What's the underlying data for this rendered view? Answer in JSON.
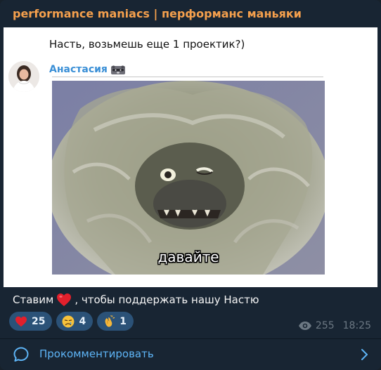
{
  "channel": {
    "title": "performance maniacs | перформанс маньяки"
  },
  "embed": {
    "question": "Насть, возьмешь еще 1 проектик?)",
    "author": "Анастасия",
    "author_emoji_icon": "raccoon-face-icon",
    "meme_caption": "давайте"
  },
  "message": {
    "before_emoji": "Ставим",
    "emoji_icon": "red-heart-icon",
    "after_emoji": ", чтобы поддержать нашу Настю"
  },
  "reactions": [
    {
      "icon": "red-heart-icon",
      "count": "25"
    },
    {
      "icon": "crying-face-icon",
      "count": "4"
    },
    {
      "icon": "clapping-hands-icon",
      "count": "1"
    }
  ],
  "meta": {
    "views": "255",
    "time": "18:25"
  },
  "comments": {
    "label": "Прокомментировать"
  },
  "colors": {
    "background": "#182533",
    "channel_title": "#f5a04d",
    "link_blue": "#5eb5f7",
    "reaction_bg": "#2b5278",
    "meta_gray": "#6c7883"
  }
}
